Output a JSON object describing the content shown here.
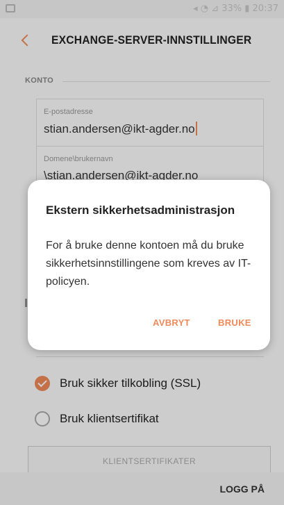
{
  "status_bar": {
    "text": "◂ ◔ ⊿ 33% ▮ 20:37"
  },
  "app_bar": {
    "title": "EXCHANGE-SERVER-INNSTILLINGER"
  },
  "account_section": {
    "label": "KONTO"
  },
  "fields": [
    {
      "label": "E-postadresse",
      "value": "stian.andersen@ikt-agder.no"
    },
    {
      "label": "Domene\\brukernavn",
      "value": "\\stian.andersen@ikt-agder.no"
    }
  ],
  "options": [
    {
      "label": "Bruk sikker tilkobling (SSL)",
      "checked": true
    },
    {
      "label": "Bruk klientsertifikat",
      "checked": false
    }
  ],
  "client_cert_button": {
    "label": "KLIENTSERTIFIKATER"
  },
  "bottom_bar": {
    "login_label": "LOGG PÅ"
  },
  "dialog": {
    "title": "Ekstern sikkerhetsadministrasjon",
    "body": "For å bruke denne kontoen må du bruke sikkerhetsinnstillingene som kreves av IT-policyen.",
    "cancel_label": "AVBRYT",
    "confirm_label": "BRUKE"
  },
  "colors": {
    "accent": "#ef8a5b"
  }
}
